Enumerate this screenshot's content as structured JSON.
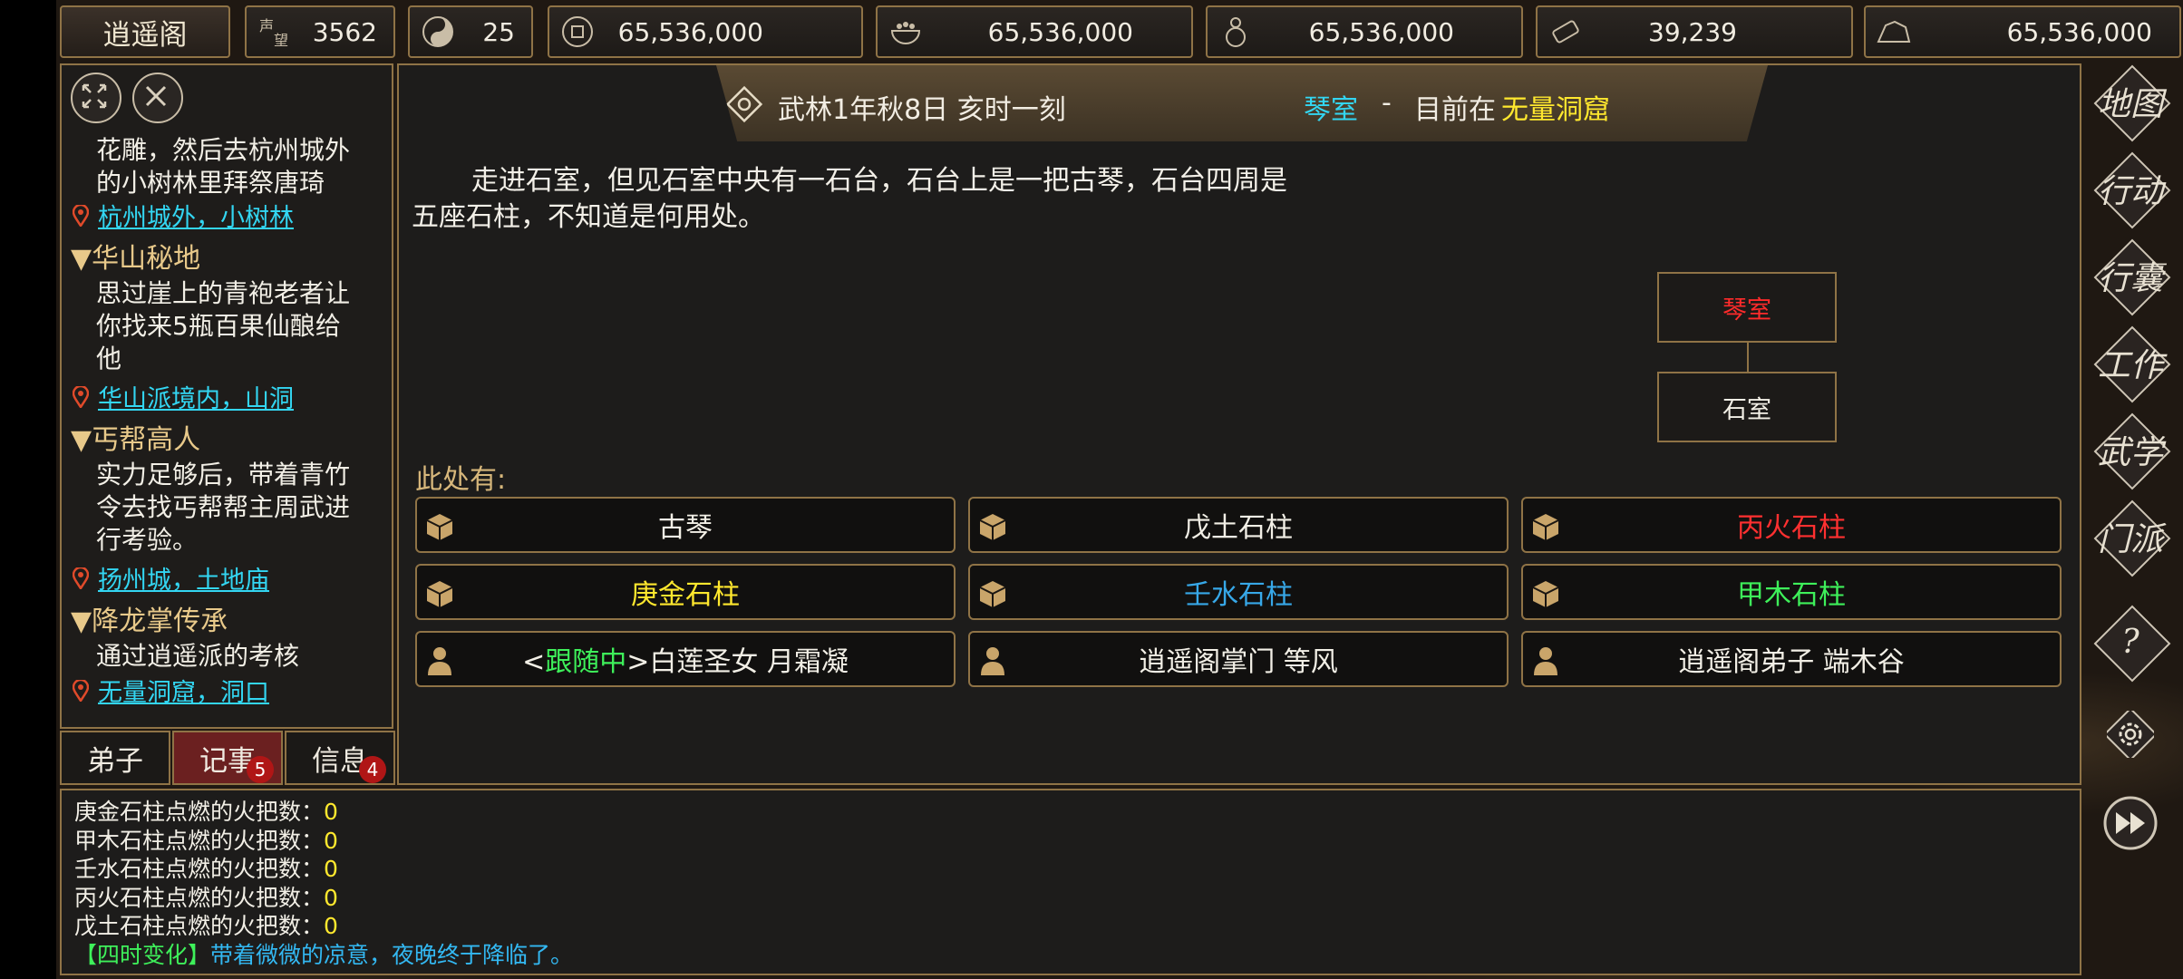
{
  "topbar": {
    "title_button": "逍遥阁",
    "resources": [
      {
        "icon": "reputation-icon",
        "value": "3562"
      },
      {
        "icon": "yin-yang-icon",
        "value": "25"
      },
      {
        "icon": "coin-icon",
        "value": "65,536,000"
      },
      {
        "icon": "rice-bowl-icon",
        "value": "65,536,000"
      },
      {
        "icon": "gourd-icon",
        "value": "65,536,000"
      },
      {
        "icon": "scroll-icon",
        "value": "39,239"
      },
      {
        "icon": "ore-icon",
        "value": "65,536,000"
      }
    ]
  },
  "quests": {
    "top_text": [
      "花雕，然后去杭州城外",
      "的小树林里拜祭唐琦"
    ],
    "top_location": "杭州城外，小树林",
    "items": [
      {
        "title": "▼华山秘地",
        "text": [
          "思过崖上的青袍老者让",
          "你找来5瓶百果仙酿给",
          "他"
        ],
        "location": "华山派境内，山洞"
      },
      {
        "title": "▼丐帮高人",
        "text": [
          "实力足够后，带着青竹",
          "令去找丐帮帮主周武进",
          "行考验。"
        ],
        "location": "扬州城，土地庙"
      },
      {
        "title": "▼降龙掌传承",
        "text": [
          "通过逍遥派的考核"
        ],
        "location": "无量洞窟，洞口"
      }
    ]
  },
  "tabs": [
    {
      "label": "弟子",
      "badge": ""
    },
    {
      "label": "记事",
      "badge": "5"
    },
    {
      "label": "信息",
      "badge": "4"
    }
  ],
  "header": {
    "time": "武林1年秋8日 亥时一刻",
    "room": "琴室",
    "separator": "-",
    "at_label": "目前在",
    "area": "无量洞窟"
  },
  "description": [
    "走进石室，但见石室中央有一石台，石台上是一把古琴，石台四周是",
    "五座石柱，不知道是何用处。"
  ],
  "minimap": {
    "current": "琴室",
    "neighbor": "石室"
  },
  "here_label": "此处有:",
  "entities": [
    {
      "label": "古琴",
      "color": "#f2efe6",
      "icon": "box-icon"
    },
    {
      "label": "戊土石柱",
      "color": "#f2efe6",
      "icon": "box-icon"
    },
    {
      "label": "丙火石柱",
      "color": "#ff3030",
      "icon": "box-icon"
    },
    {
      "label": "庚金石柱",
      "color": "#ffe82e",
      "icon": "box-icon"
    },
    {
      "label": "壬水石柱",
      "color": "#37a8e8",
      "icon": "box-icon"
    },
    {
      "label": "甲木石柱",
      "color": "#3ef05a",
      "icon": "box-icon"
    },
    {
      "label_pre": "<",
      "label_tag": "跟随中",
      "label_post": ">白莲圣女 月霜凝",
      "color": "#f2efe6",
      "tag_color": "#3ef05a",
      "icon": "person-icon"
    },
    {
      "label": "逍遥阁掌门 等风",
      "color": "#f2efe6",
      "icon": "person-icon"
    },
    {
      "label": "逍遥阁弟子 端木谷",
      "color": "#f2efe6",
      "icon": "person-icon"
    }
  ],
  "log": {
    "lines": [
      {
        "text": "庚金石柱点燃的火把数：",
        "num": "0"
      },
      {
        "text": "甲木石柱点燃的火把数：",
        "num": "0"
      },
      {
        "text": "壬水石柱点燃的火把数：",
        "num": "0"
      },
      {
        "text": "丙火石柱点燃的火把数：",
        "num": "0"
      },
      {
        "text": "戊土石柱点燃的火把数：",
        "num": "0"
      }
    ],
    "season_tag": "【四时变化】",
    "season_text": "带着微微的凉意，夜晚终于降临了。"
  },
  "right_menu": [
    {
      "label": "地图",
      "icon": "map-icon"
    },
    {
      "label": "行动",
      "icon": "action-icon"
    },
    {
      "label": "行囊",
      "icon": "bag-icon"
    },
    {
      "label": "工作",
      "icon": "work-icon"
    },
    {
      "label": "武学",
      "icon": "martial-icon"
    },
    {
      "label": "门派",
      "icon": "sect-icon"
    },
    {
      "label": "?",
      "icon": "help-icon"
    },
    {
      "label": "",
      "icon": "settings-gear-icon"
    },
    {
      "label": "",
      "icon": "fast-forward-icon"
    }
  ],
  "colors": {
    "border": "#8f7346",
    "cyan": "#33d6f2",
    "yellow": "#ffe82e",
    "green": "#3ef05a",
    "red": "#ff3030",
    "blue": "#37a8e8"
  }
}
